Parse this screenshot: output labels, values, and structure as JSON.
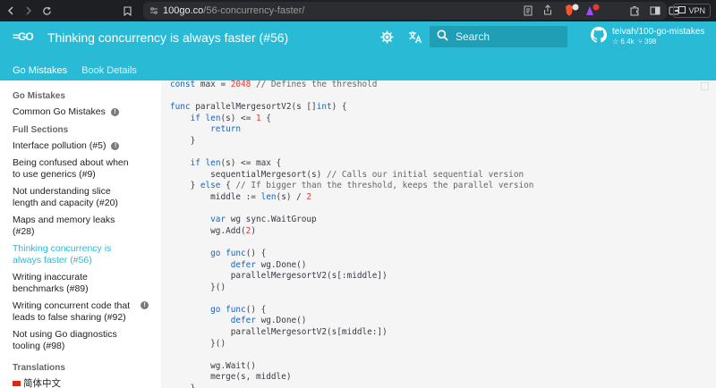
{
  "browser": {
    "url_domain": "100go.co",
    "url_path": "/56-concurrency-faster/",
    "vpn_label": "VPN"
  },
  "header": {
    "logo": "=GO",
    "title": "Thinking concurrency is always faster (#56)",
    "search_placeholder": "Search",
    "repo_name": "teivah/100-go-mistakes",
    "repo_stars": "6.4k",
    "repo_forks": "398",
    "tabs": [
      {
        "label": "Go Mistakes"
      },
      {
        "label": "Book Details"
      }
    ]
  },
  "sidebar": {
    "section1": "Go Mistakes",
    "common": "Common Go Mistakes",
    "section2": "Full Sections",
    "items": [
      {
        "label": "Interface pollution (#5)"
      },
      {
        "label": "Being confused about when to use generics (#9)"
      },
      {
        "label": "Not understanding slice length and capacity (#20)"
      },
      {
        "label": "Maps and memory leaks (#28)"
      },
      {
        "label": "Thinking concurrency is always faster (#56)"
      },
      {
        "label": "Writing inaccurate benchmarks (#89)"
      },
      {
        "label": "Writing concurrent code that leads to false sharing (#92)"
      },
      {
        "label": "Not using Go diagnostics tooling (#98)"
      }
    ],
    "section3": "Translations",
    "translation": "简体中文"
  },
  "colors": {
    "header": "#29bbd6",
    "active_link": "#29bbd6"
  }
}
